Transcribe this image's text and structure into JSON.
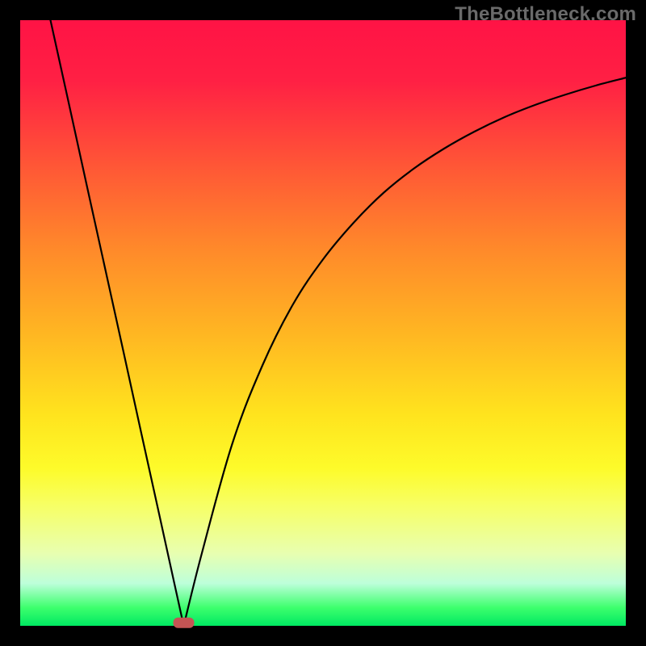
{
  "watermark": "TheBottleneck.com",
  "colors": {
    "background": "#000000",
    "curve": "#000000",
    "min_marker": "#c45454",
    "gradient_top": "#ff1345",
    "gradient_bottom": "#00e862"
  },
  "chart_data": {
    "type": "line",
    "title": "",
    "xlabel": "",
    "ylabel": "",
    "xlim": [
      0,
      100
    ],
    "ylim": [
      0,
      100
    ],
    "annotations": [
      {
        "kind": "minimum_marker",
        "x": 27,
        "y": 0.5,
        "shape": "rounded-pill"
      }
    ],
    "series": [
      {
        "name": "left-branch",
        "x": [
          5.0,
          8.0,
          11.0,
          14.0,
          17.0,
          20.0,
          23.0,
          25.5,
          27.0
        ],
        "y": [
          100.0,
          86.4,
          72.7,
          59.1,
          45.5,
          31.8,
          18.2,
          6.8,
          0.0
        ]
      },
      {
        "name": "right-branch",
        "x": [
          27.0,
          30.0,
          35.0,
          40.0,
          45.0,
          50.0,
          55.0,
          60.0,
          65.0,
          70.0,
          75.0,
          80.0,
          85.0,
          90.0,
          95.0,
          100.0
        ],
        "y": [
          0.0,
          12.0,
          30.0,
          43.0,
          53.0,
          60.5,
          66.5,
          71.5,
          75.5,
          78.8,
          81.6,
          84.0,
          86.0,
          87.7,
          89.2,
          90.5
        ]
      }
    ]
  }
}
